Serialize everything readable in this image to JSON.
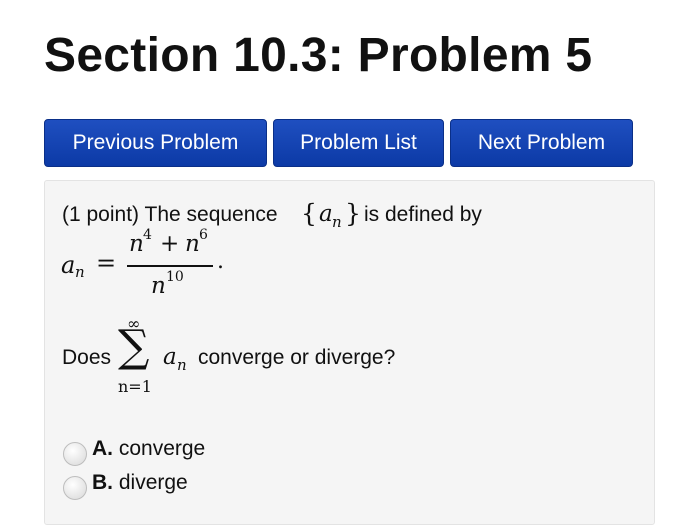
{
  "header": {
    "title": "Section 10.3: Problem 5"
  },
  "nav": {
    "previous_label": "Previous Problem",
    "list_label": "Problem List",
    "next_label": "Next Problem"
  },
  "problem": {
    "intro_points": "(1 point) The sequence",
    "brace_open": "{",
    "brace_close": "}",
    "seq_var": "a",
    "seq_sub": "n",
    "intro_rest": "is defined by",
    "lhs_var": "a",
    "lhs_sub": "n",
    "equals": "=",
    "num_n1": "n",
    "num_exp1": "4",
    "num_plus": "+",
    "num_n2": "n",
    "num_exp2": "6",
    "den_n": "n",
    "den_exp": "10",
    "period": ".",
    "question_prefix": "Does",
    "sum_top": "∞",
    "sum_symbol": "∑",
    "sum_bottom": "n=1",
    "sum_var": "a",
    "sum_sub": "n",
    "question_suffix": "converge or diverge?"
  },
  "options": [
    {
      "letter": "A.",
      "text": "converge"
    },
    {
      "letter": "B.",
      "text": "diverge"
    }
  ]
}
